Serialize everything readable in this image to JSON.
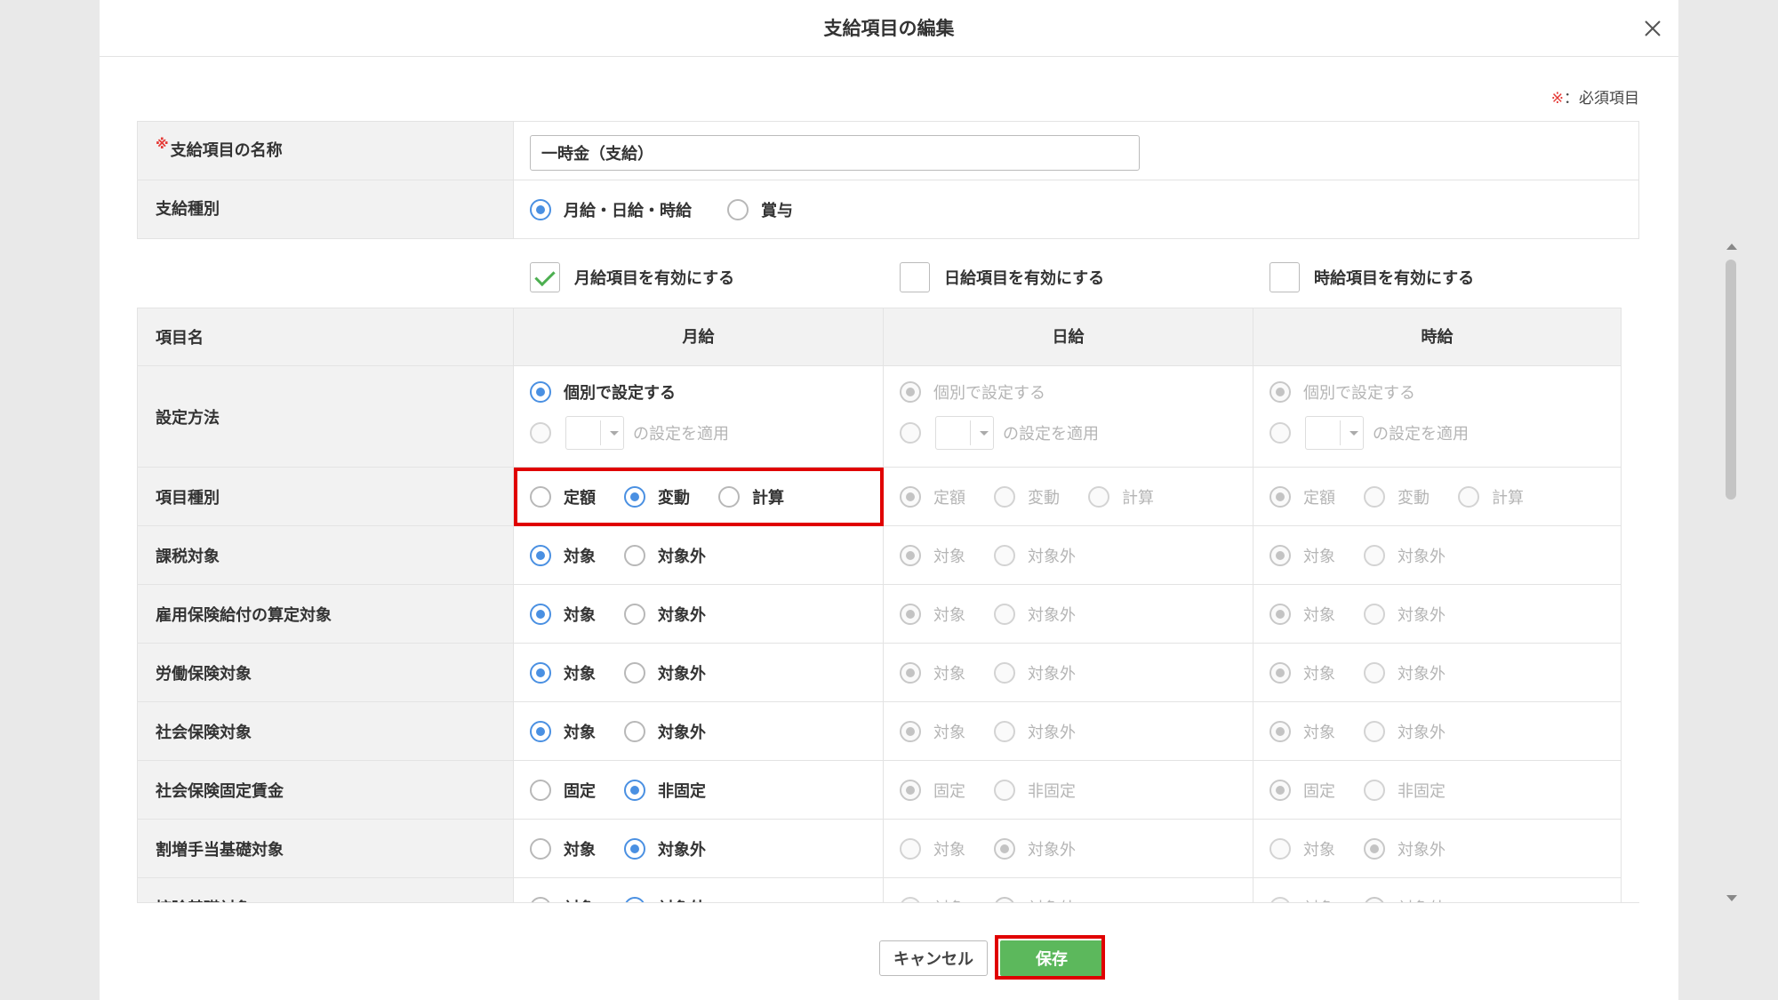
{
  "dialog": {
    "title": "支給項目の編集",
    "required_note_mark": "※",
    "required_note_text": "：必須項目"
  },
  "form": {
    "name_label": "支給項目の名称",
    "name_required_mark": "※",
    "name_value": "一時金（支給）",
    "type_label": "支給種別",
    "type_options": [
      "月給・日給・時給",
      "賞与"
    ],
    "type_selected": "月給・日給・時給"
  },
  "enable_checks": [
    {
      "label": "月給項目を有効にする",
      "checked": true
    },
    {
      "label": "日給項目を有効にする",
      "checked": false
    },
    {
      "label": "時給項目を有効にする",
      "checked": false
    }
  ],
  "grid": {
    "header": {
      "item": "項目名",
      "monthly": "月給",
      "daily": "日給",
      "hourly": "時給"
    },
    "setting_method": {
      "label": "設定方法",
      "individual": "個別で設定する",
      "apply": "の設定を適用"
    },
    "rows": [
      {
        "label": "項目種別",
        "options": [
          "定額",
          "変動",
          "計算"
        ],
        "monthly": "変動",
        "disabled_selected": "定額"
      },
      {
        "label": "課税対象",
        "options": [
          "対象",
          "対象外"
        ],
        "monthly": "対象",
        "disabled_selected": "対象"
      },
      {
        "label": "雇用保険給付の算定対象",
        "options": [
          "対象",
          "対象外"
        ],
        "monthly": "対象",
        "disabled_selected": "対象"
      },
      {
        "label": "労働保険対象",
        "options": [
          "対象",
          "対象外"
        ],
        "monthly": "対象",
        "disabled_selected": "対象"
      },
      {
        "label": "社会保険対象",
        "options": [
          "対象",
          "対象外"
        ],
        "monthly": "対象",
        "disabled_selected": "対象"
      },
      {
        "label": "社会保険固定賃金",
        "options": [
          "固定",
          "非固定"
        ],
        "monthly": "非固定",
        "disabled_selected": "固定"
      },
      {
        "label": "割増手当基礎対象",
        "options": [
          "対象",
          "対象外"
        ],
        "monthly": "対象外",
        "disabled_selected": "対象外"
      },
      {
        "label": "控除基礎対象",
        "options": [
          "対象",
          "対象外"
        ],
        "monthly": "対象外",
        "disabled_selected": "対象外"
      }
    ]
  },
  "footer": {
    "cancel_label": "キャンセル",
    "save_label": "保存"
  },
  "colors": {
    "accent": "#4a90e2",
    "save": "#5cb85c",
    "required": "#e53935",
    "highlight": "#e00000"
  }
}
